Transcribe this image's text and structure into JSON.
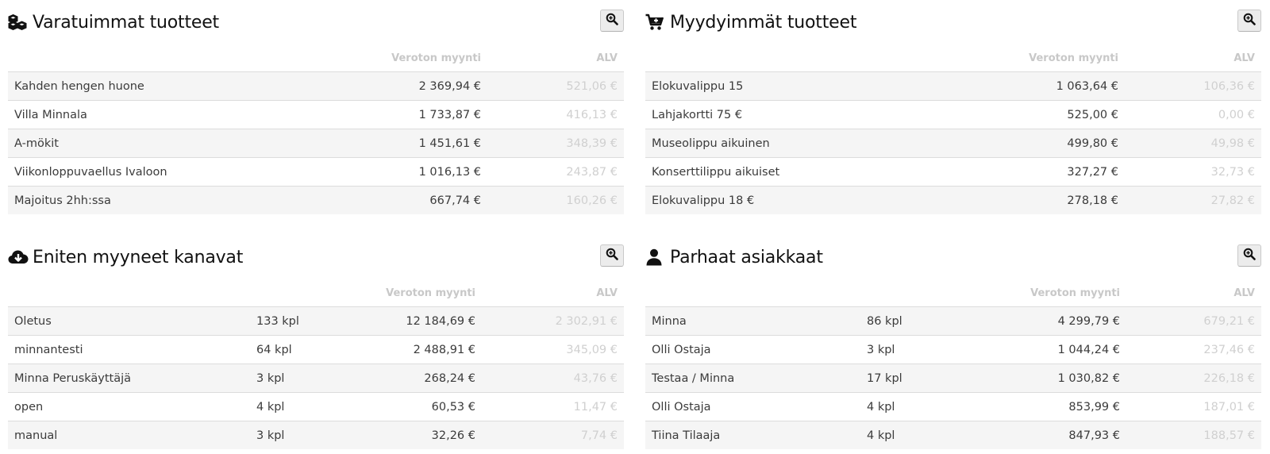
{
  "panels": {
    "top_products": {
      "title": "Varatuimmat tuotteet",
      "icon": "cubes-icon",
      "headers": {
        "sales": "Veroton myynti",
        "vat": "ALV"
      },
      "rows": [
        {
          "name": "Kahden hengen huone",
          "sales": "2 369,94 €",
          "vat": "521,06 €"
        },
        {
          "name": "Villa Minnala",
          "sales": "1 733,87 €",
          "vat": "416,13 €"
        },
        {
          "name": "A-mökit",
          "sales": "1 451,61 €",
          "vat": "348,39 €"
        },
        {
          "name": "Viikonloppuvaellus Ivaloon",
          "sales": "1 016,13 €",
          "vat": "243,87 €"
        },
        {
          "name": "Majoitus 2hh:ssa",
          "sales": "667,74 €",
          "vat": "160,26 €"
        }
      ]
    },
    "best_selling": {
      "title": "Myydyimmät tuotteet",
      "icon": "cart-plus-icon",
      "headers": {
        "sales": "Veroton myynti",
        "vat": "ALV"
      },
      "rows": [
        {
          "name": "Elokuvalippu 15",
          "sales": "1 063,64 €",
          "vat": "106,36 €"
        },
        {
          "name": "Lahjakortti 75 €",
          "sales": "525,00 €",
          "vat": "0,00 €"
        },
        {
          "name": "Museolippu aikuinen",
          "sales": "499,80 €",
          "vat": "49,98 €"
        },
        {
          "name": "Konserttilippu aikuiset",
          "sales": "327,27 €",
          "vat": "32,73 €"
        },
        {
          "name": "Elokuvalippu 18 €",
          "sales": "278,18 €",
          "vat": "27,82 €"
        }
      ]
    },
    "top_channels": {
      "title": "Eniten myyneet kanavat",
      "icon": "cloud-download-icon",
      "headers": {
        "sales": "Veroton myynti",
        "vat": "ALV"
      },
      "rows": [
        {
          "name": "Oletus",
          "qty": "133 kpl",
          "sales": "12 184,69 €",
          "vat": "2 302,91 €"
        },
        {
          "name": "minnantesti",
          "qty": "64 kpl",
          "sales": "2 488,91 €",
          "vat": "345,09 €"
        },
        {
          "name": "Minna Peruskäyttäjä",
          "qty": "3 kpl",
          "sales": "268,24 €",
          "vat": "43,76 €"
        },
        {
          "name": "open",
          "qty": "4 kpl",
          "sales": "60,53 €",
          "vat": "11,47 €"
        },
        {
          "name": "manual",
          "qty": "3 kpl",
          "sales": "32,26 €",
          "vat": "7,74 €"
        }
      ]
    },
    "top_customers": {
      "title": "Parhaat asiakkaat",
      "icon": "user-icon",
      "headers": {
        "sales": "Veroton myynti",
        "vat": "ALV"
      },
      "rows": [
        {
          "name": "Minna",
          "qty": "86 kpl",
          "sales": "4 299,79 €",
          "vat": "679,21 €"
        },
        {
          "name": "Olli Ostaja",
          "qty": "3 kpl",
          "sales": "1 044,24 €",
          "vat": "237,46 €"
        },
        {
          "name": "Testaa / Minna",
          "qty": "17 kpl",
          "sales": "1 030,82 €",
          "vat": "226,18 €"
        },
        {
          "name": "Olli Ostaja",
          "qty": "4 kpl",
          "sales": "853,99 €",
          "vat": "187,01 €"
        },
        {
          "name": "Tiina Tilaaja",
          "qty": "4 kpl",
          "sales": "847,93 €",
          "vat": "188,57 €"
        }
      ]
    }
  },
  "zoom_icon": "zoom-in-icon",
  "colors": {
    "row_stripe": "#f5f5f5",
    "header_text": "#c8c8c8",
    "vat_text": "#d0d0d0",
    "title_text": "#111111"
  }
}
